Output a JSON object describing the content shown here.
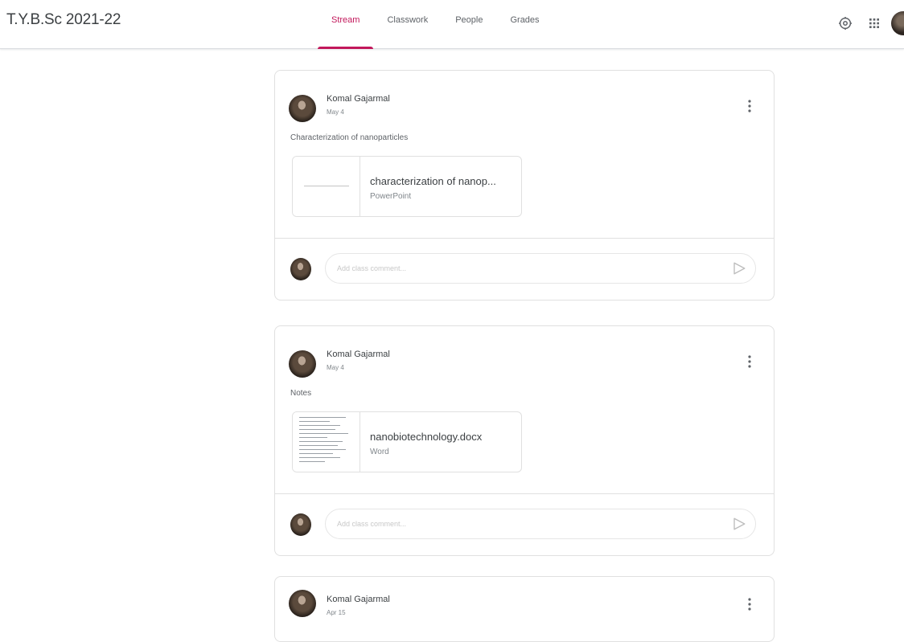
{
  "header": {
    "class_title": "T.Y.B.Sc 2021-22",
    "tabs": [
      {
        "label": "Stream",
        "active": true
      },
      {
        "label": "Classwork",
        "active": false
      },
      {
        "label": "People",
        "active": false
      },
      {
        "label": "Grades",
        "active": false
      }
    ],
    "icons": [
      "settings-icon",
      "apps-grid-icon",
      "account-avatar"
    ]
  },
  "colors": {
    "accent": "#c2185b",
    "border": "#e0e0e0",
    "text": "#3c4043",
    "muted": "#80868b"
  },
  "posts": [
    {
      "author": "Komal Gajarmal",
      "date": "May 4",
      "text": "Characterization of nanoparticles",
      "attachment": {
        "title": "characterization of nanop...",
        "type": "PowerPoint",
        "thumb": "blank-slide"
      },
      "comment_placeholder": "Add class comment..."
    },
    {
      "author": "Komal Gajarmal",
      "date": "May 4",
      "text": "Notes",
      "attachment": {
        "title": "nanobiotechnology.docx",
        "type": "Word",
        "thumb": "document-page"
      },
      "comment_placeholder": "Add class comment..."
    },
    {
      "author": "Komal Gajarmal",
      "date": "Apr 15"
    }
  ]
}
